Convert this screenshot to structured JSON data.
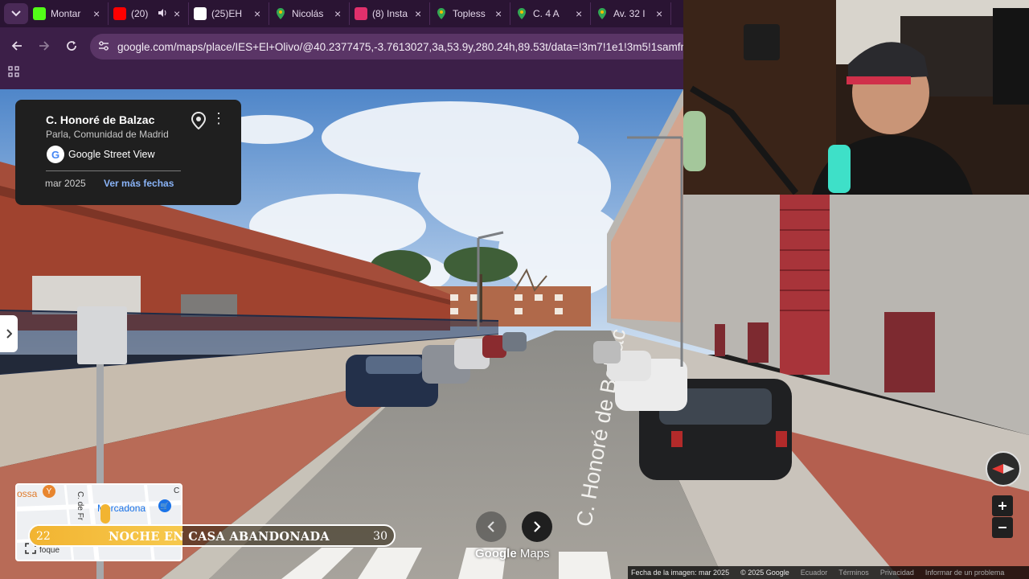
{
  "browser": {
    "tab_menu_icon": "chevron-down-icon",
    "tabs": [
      {
        "title": "Montar",
        "favicon": "kick-icon",
        "color": "#53fc18"
      },
      {
        "title": "(20)",
        "favicon": "youtube-icon",
        "color": "#ff0000",
        "audio": true
      },
      {
        "title": "(25)EH",
        "favicon": "tiktok-icon",
        "color": "#ffffff"
      },
      {
        "title": "Nicolás",
        "favicon": "maps-pin-icon",
        "color": "#34a853"
      },
      {
        "title": "(8) Insta",
        "favicon": "instagram-icon",
        "color": "#e1306c"
      },
      {
        "title": "Topless",
        "favicon": "maps-pin-icon",
        "color": "#34a853"
      },
      {
        "title": "C. 4 A",
        "favicon": "maps-pin-icon",
        "color": "#34a853"
      },
      {
        "title": "Av. 32 I",
        "favicon": "maps-pin-icon",
        "color": "#34a853"
      }
    ],
    "tab_close": "×",
    "url": "google.com/maps/place/IES+El+Olivo/@40.2377475,-3.7613027,3a,53.9y,280.24h,89.53t/data=!3m7!1e1!3m5!1samfnP_a"
  },
  "location_card": {
    "street": "C. Honoré de Balzac",
    "region": "Parla, Comunidad de Madrid",
    "source": "Google Street View",
    "capture_date": "mar 2025",
    "more_dates_link": "Ver más fechas"
  },
  "street_label": "C. Honoré de Balzac",
  "brand": {
    "google": "Google",
    "maps": "Maps"
  },
  "minimap": {
    "labels": [
      "ossa",
      "C. de Fr",
      "Mercadona",
      "foque",
      "C"
    ]
  },
  "stream_overlay": {
    "start_value": "22",
    "title": "NOCHE EN CASA ABANDONADA",
    "end_value": "30",
    "progress": 0.42
  },
  "footer": {
    "image_date": "Fecha de la imagen: mar 2025",
    "copyright": "© 2025 Google",
    "country": "Ecuador",
    "terms": "Términos",
    "privacy": "Privacidad",
    "report": "Informar de un problema"
  },
  "colors": {
    "chrome": "#3c1f48",
    "tabstrip": "#2a1433",
    "accent_gold": "#f2b431",
    "link_blue": "#8ab4f8"
  }
}
